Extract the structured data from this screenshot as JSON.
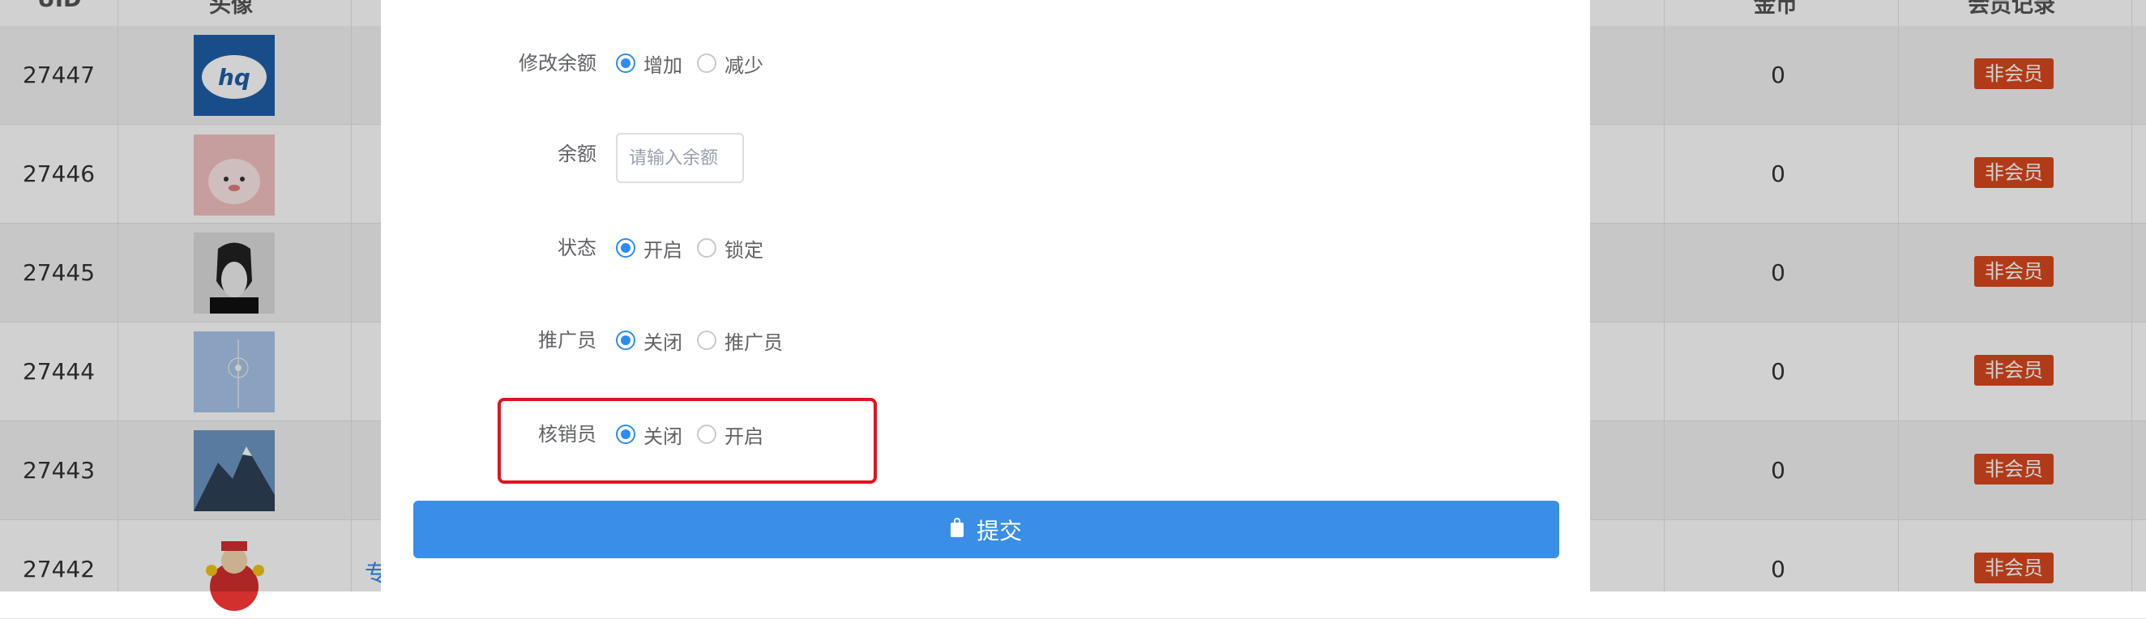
{
  "table": {
    "headers": {
      "uid": "UID",
      "avatar": "头像",
      "coins": "金币",
      "member_record": "会员记录"
    },
    "rows": [
      {
        "uid": "27447",
        "coins": "0",
        "badge": "非会员"
      },
      {
        "uid": "27446",
        "coins": "0",
        "badge": "非会员"
      },
      {
        "uid": "27445",
        "coins": "0",
        "badge": "非会员"
      },
      {
        "uid": "27444",
        "coins": "0",
        "badge": "非会员"
      },
      {
        "uid": "27443",
        "coins": "0",
        "badge": "非会员"
      },
      {
        "uid": "27442",
        "coins": "0",
        "badge": "非会员",
        "link": "专"
      }
    ]
  },
  "form": {
    "balance_change": {
      "label": "修改余额",
      "options": [
        "增加",
        "减少"
      ],
      "selected": "增加"
    },
    "balance": {
      "label": "余额",
      "placeholder": "请输入余额"
    },
    "status": {
      "label": "状态",
      "options": [
        "开启",
        "锁定"
      ],
      "selected": "开启"
    },
    "promoter": {
      "label": "推广员",
      "options": [
        "关闭",
        "推广员"
      ],
      "selected": "关闭"
    },
    "verifier": {
      "label": "核销员",
      "options": [
        "关闭",
        "开启"
      ],
      "selected": "关闭"
    },
    "submit_label": "提交"
  },
  "colors": {
    "primary": "#2d8cf0",
    "badge": "#d8481f",
    "highlight": "#e01320"
  }
}
